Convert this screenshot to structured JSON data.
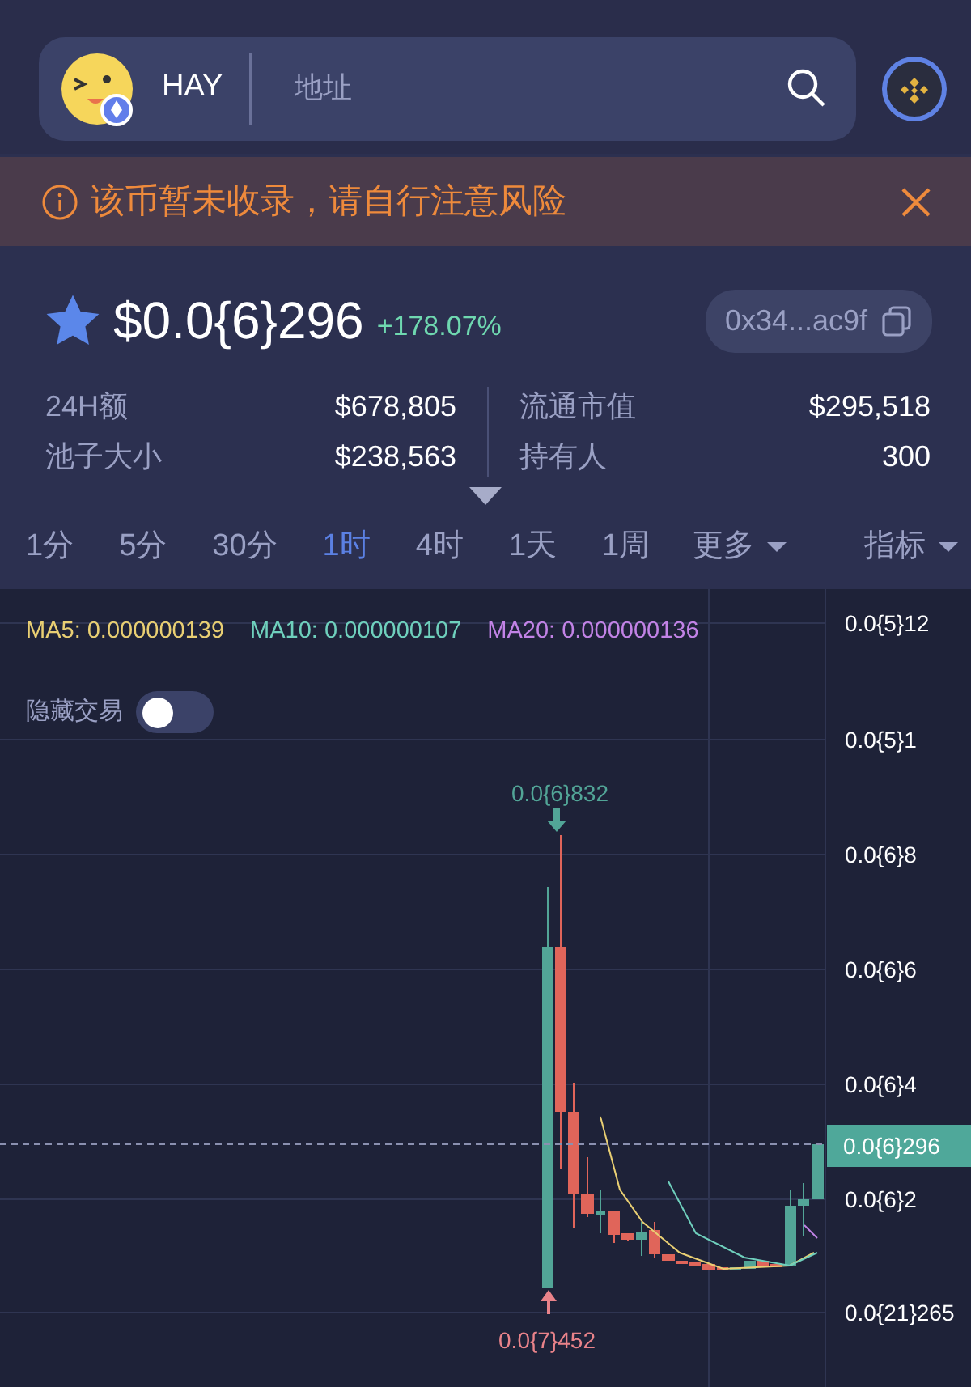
{
  "token": {
    "symbol": "HAY"
  },
  "search": {
    "placeholder": "地址"
  },
  "warning": {
    "text": "该币暂未收录，请自行注意风险"
  },
  "price": {
    "favorite": true,
    "value": "$0.0{6}296",
    "change": "+178.07%",
    "address": "0x34...ac9f"
  },
  "stats": [
    {
      "label": "24H额",
      "value": "$678,805"
    },
    {
      "label": "池子大小",
      "value": "$238,563"
    },
    {
      "label": "流通市值",
      "value": "$295,518"
    },
    {
      "label": "持有人",
      "value": "300"
    }
  ],
  "timeframes": [
    {
      "label": "1分",
      "selected": false
    },
    {
      "label": "5分",
      "selected": false
    },
    {
      "label": "30分",
      "selected": false
    },
    {
      "label": "1时",
      "selected": true
    },
    {
      "label": "4时",
      "selected": false
    },
    {
      "label": "1天",
      "selected": false
    },
    {
      "label": "1周",
      "selected": false
    }
  ],
  "menus": [
    {
      "label": "更多"
    },
    {
      "label": "指标"
    }
  ],
  "chart": {
    "ma": [
      {
        "label": "MA5: 0.000000139",
        "color": "#e9cf73"
      },
      {
        "label": "MA10: 0.000000107",
        "color": "#6fd0bd"
      },
      {
        "label": "MA20: 0.000000136",
        "color": "#c283e6"
      }
    ],
    "hide_trades": {
      "label": "隐藏交易",
      "on": false
    },
    "y_axis": [
      "0.0{5}12",
      "0.0{5}1",
      "0.0{6}8",
      "0.0{6}6",
      "0.0{6}4",
      "0.0{6}2",
      "0.0{21}265"
    ],
    "current_price": "0.0{6}296",
    "high_marker": "0.0{6}832",
    "low_marker": "0.0{7}452"
  }
}
